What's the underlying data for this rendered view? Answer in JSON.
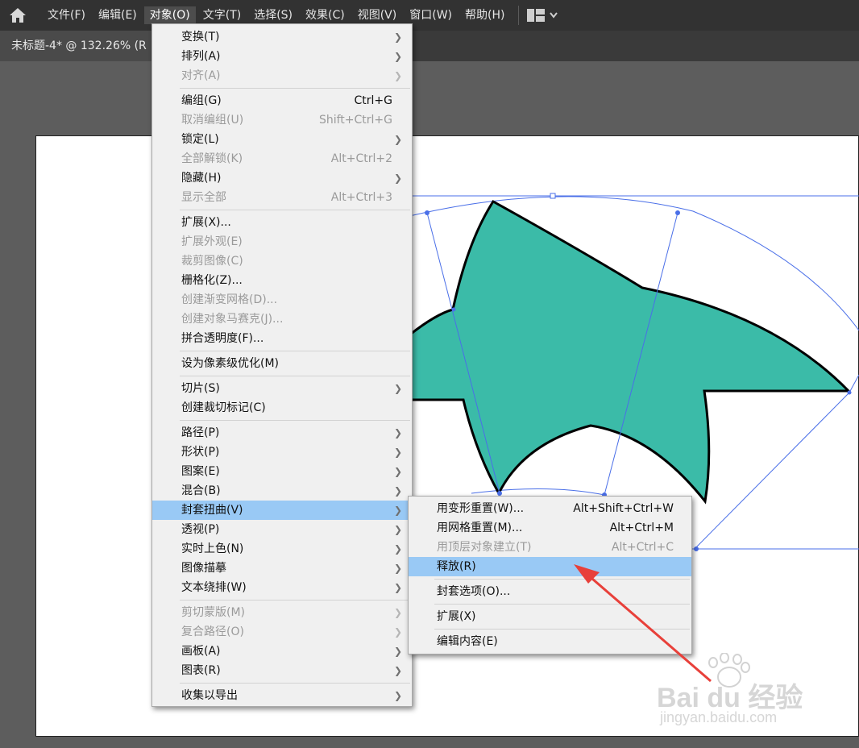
{
  "menubar": {
    "items": [
      "文件(F)",
      "编辑(E)",
      "对象(O)",
      "文字(T)",
      "选择(S)",
      "效果(C)",
      "视图(V)",
      "窗口(W)",
      "帮助(H)"
    ],
    "active_index": 2
  },
  "tab": {
    "title": "未标题-4* @ 132.26% (R"
  },
  "object_menu": [
    {
      "label": "变换(T)",
      "sub": true
    },
    {
      "label": "排列(A)",
      "sub": true
    },
    {
      "label": "对齐(A)",
      "sub": true,
      "disabled": true
    },
    {
      "divider": true
    },
    {
      "label": "编组(G)",
      "shortcut": "Ctrl+G"
    },
    {
      "label": "取消编组(U)",
      "shortcut": "Shift+Ctrl+G",
      "disabled": true
    },
    {
      "label": "锁定(L)",
      "sub": true
    },
    {
      "label": "全部解锁(K)",
      "shortcut": "Alt+Ctrl+2",
      "disabled": true
    },
    {
      "label": "隐藏(H)",
      "sub": true
    },
    {
      "label": "显示全部",
      "shortcut": "Alt+Ctrl+3",
      "disabled": true
    },
    {
      "divider": true
    },
    {
      "label": "扩展(X)..."
    },
    {
      "label": "扩展外观(E)",
      "disabled": true
    },
    {
      "label": "裁剪图像(C)",
      "disabled": true
    },
    {
      "label": "栅格化(Z)..."
    },
    {
      "label": "创建渐变网格(D)...",
      "disabled": true
    },
    {
      "label": "创建对象马赛克(J)...",
      "disabled": true
    },
    {
      "label": "拼合透明度(F)..."
    },
    {
      "divider": true
    },
    {
      "label": "设为像素级优化(M)"
    },
    {
      "divider": true
    },
    {
      "label": "切片(S)",
      "sub": true
    },
    {
      "label": "创建裁切标记(C)"
    },
    {
      "divider": true
    },
    {
      "label": "路径(P)",
      "sub": true
    },
    {
      "label": "形状(P)",
      "sub": true
    },
    {
      "label": "图案(E)",
      "sub": true
    },
    {
      "label": "混合(B)",
      "sub": true
    },
    {
      "label": "封套扭曲(V)",
      "sub": true,
      "highlight": true
    },
    {
      "label": "透视(P)",
      "sub": true
    },
    {
      "label": "实时上色(N)",
      "sub": true
    },
    {
      "label": "图像描摹",
      "sub": true
    },
    {
      "label": "文本绕排(W)",
      "sub": true
    },
    {
      "divider": true
    },
    {
      "label": "剪切蒙版(M)",
      "sub": true,
      "disabled": true
    },
    {
      "label": "复合路径(O)",
      "sub": true,
      "disabled": true
    },
    {
      "label": "画板(A)",
      "sub": true
    },
    {
      "label": "图表(R)",
      "sub": true
    },
    {
      "divider": true
    },
    {
      "label": "收集以导出",
      "sub": true
    }
  ],
  "envelope_submenu": [
    {
      "label": "用变形重置(W)...",
      "shortcut": "Alt+Shift+Ctrl+W"
    },
    {
      "label": "用网格重置(M)...",
      "shortcut": "Alt+Ctrl+M"
    },
    {
      "label": "用顶层对象建立(T)",
      "shortcut": "Alt+Ctrl+C",
      "disabled": true
    },
    {
      "label": "释放(R)",
      "highlight": true
    },
    {
      "divider": true
    },
    {
      "label": "封套选项(O)..."
    },
    {
      "divider": true
    },
    {
      "label": "扩展(X)"
    },
    {
      "divider": true
    },
    {
      "label": "编辑内容(E)"
    }
  ],
  "watermark": {
    "brand": "Bai du 经验",
    "url": "jingyan.baidu.com"
  },
  "colors": {
    "shape_fill": "#3bbba8",
    "selection": "#4a6fe8",
    "menu_highlight": "#99c9f5",
    "arrow": "#e8403a"
  },
  "icons": {
    "home": "home-icon",
    "workspace": "workspace-switcher-icon",
    "submenu": "chevron-right-icon"
  }
}
